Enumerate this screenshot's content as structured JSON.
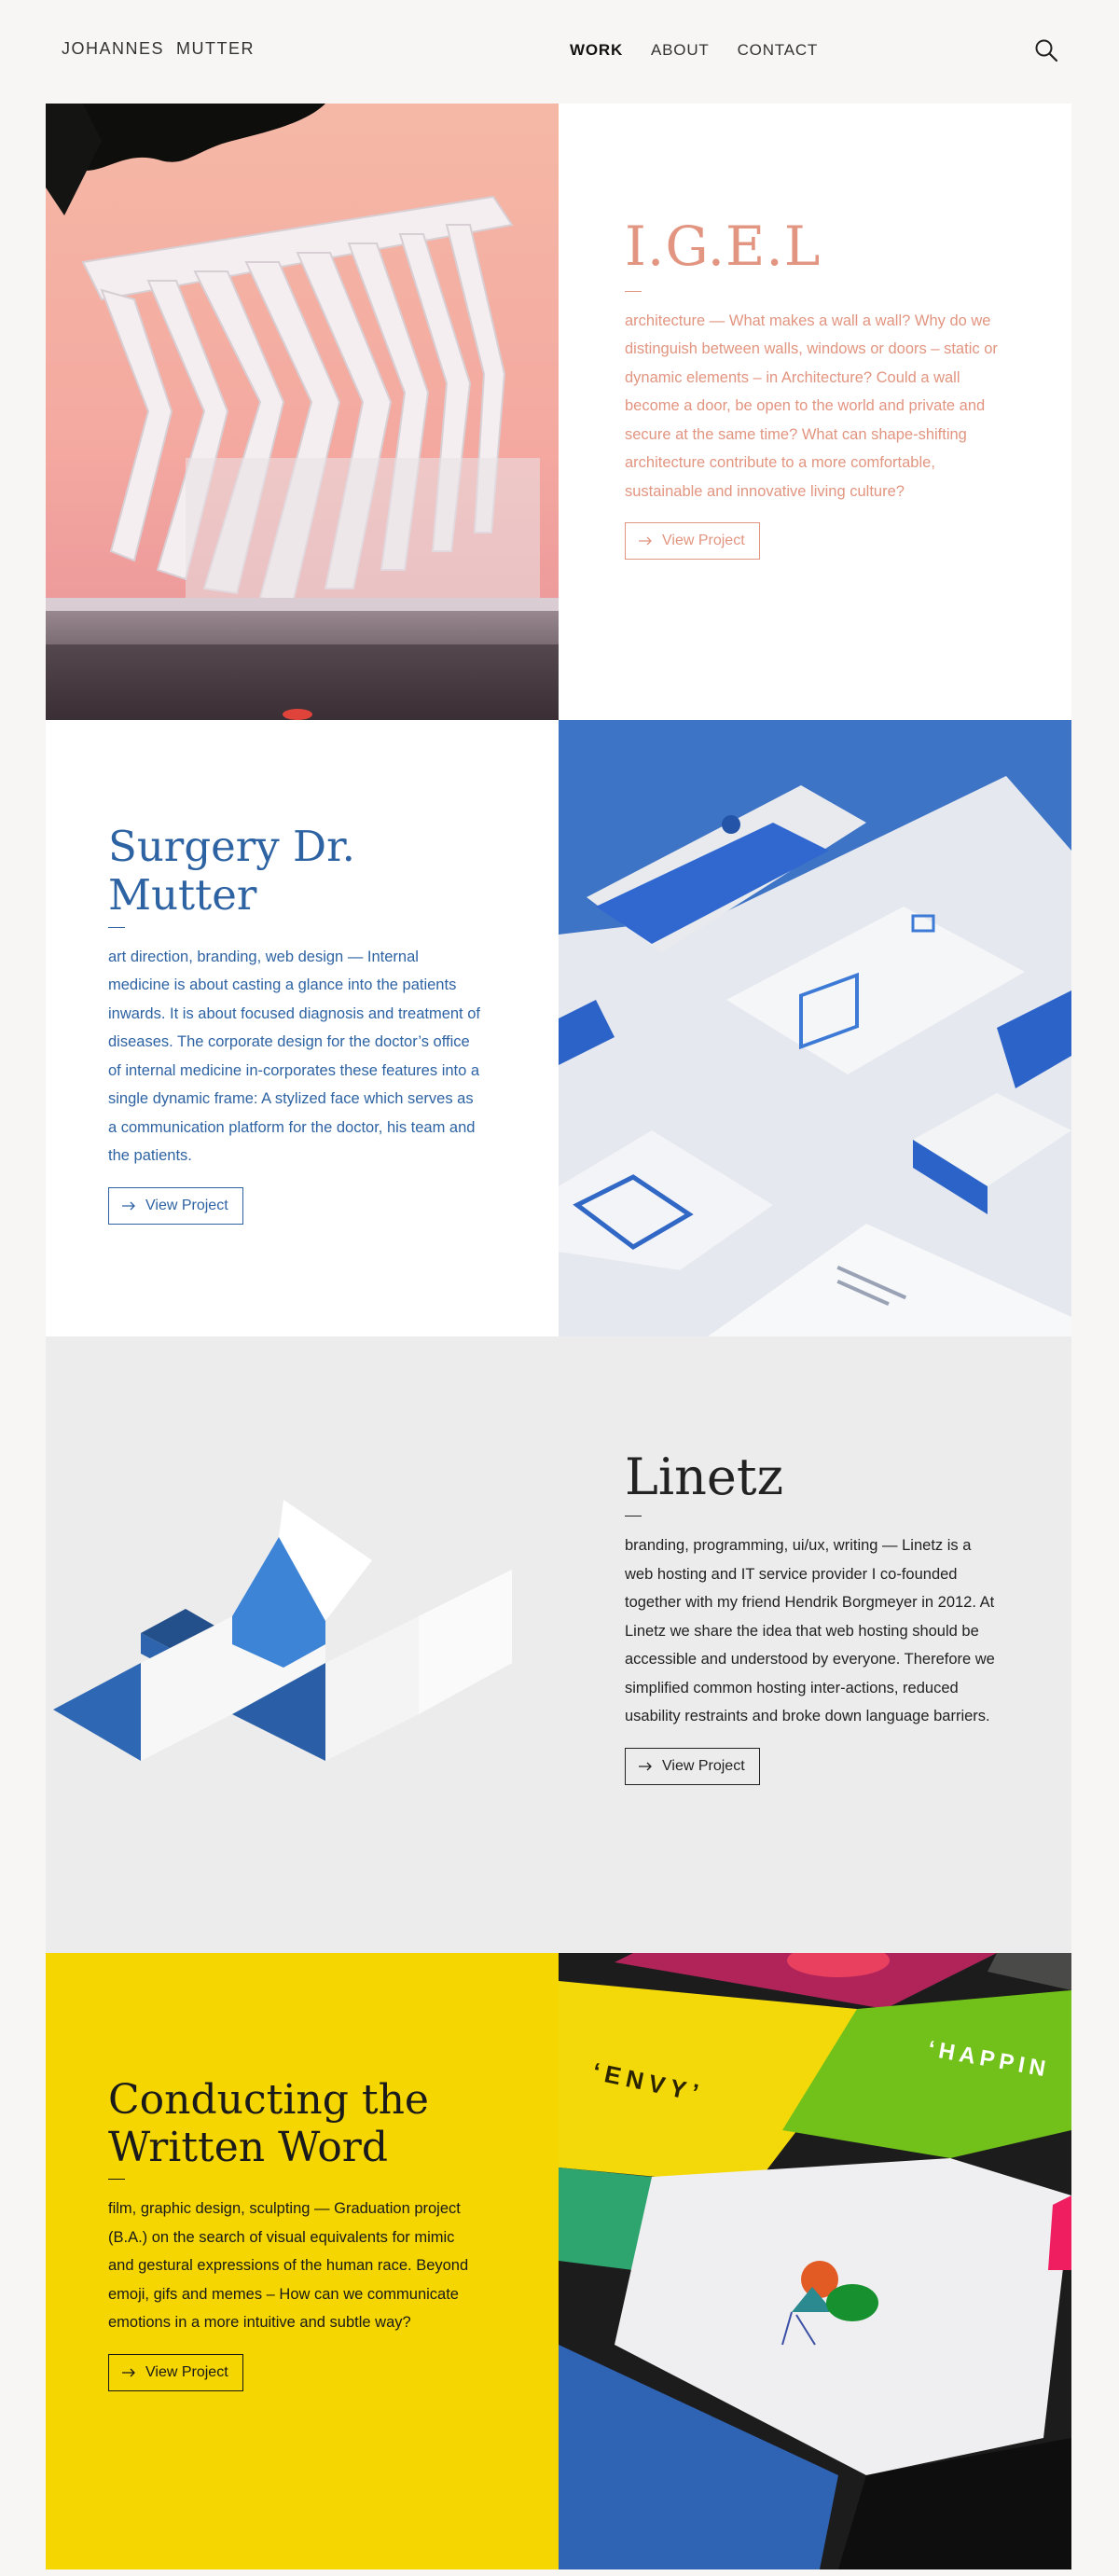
{
  "header": {
    "logo": "JOHANNES  MUTTER",
    "nav": [
      {
        "label": "WORK",
        "active": true
      },
      {
        "label": "ABOUT",
        "active": false
      },
      {
        "label": "CONTACT",
        "active": false
      }
    ],
    "search_icon": "search-icon"
  },
  "projects": [
    {
      "title": "I.G.E.L",
      "description": "architecture — What makes a wall a wall? Why do we distinguish between walls, windows or doors – static or dynamic elements – in Architecture? Could a wall become a door, be open to the world and private and secure at the same time? What can shape-shifting architecture contribute to a more comfortable, sustainable and innovative living culture?",
      "button": "View Project",
      "accent": "#e29580"
    },
    {
      "title": "Surgery Dr. Mutter",
      "description": "art direction, branding, web design — Internal medicine is about casting a glance into the patients inwards. It is about focused diagnosis and treatment of diseases. The corporate design for the doctor’s office of internal medicine in-corporates these features into a single dynamic frame: A stylized face which serves as a communication platform for the doctor, his team and the patients.",
      "button": "View Project",
      "accent": "#2e63a3"
    },
    {
      "title": "Linetz",
      "description": "branding, programming, ui/ux, writing — Linetz is a web hosting and IT service provider I co-founded together with my friend Hendrik Borgmeyer in 2012. At Linetz we share the idea that web hosting should be accessible and understood by everyone. Therefore we simplified common hosting inter-actions, reduced usability restraints and broke down language barriers.",
      "button": "View Project",
      "accent": "#222222"
    },
    {
      "title": "Conducting the Written Word",
      "description": "film, graphic design, sculpting — Graduation project (B.A.) on the search of visual equivalents for mimic and gestural expressions of the human race. Beyond emoji, gifs and memes – How can we communicate emotions in a more intuitive and subtle way?",
      "button": "View Project",
      "accent": "#f6d600"
    }
  ],
  "artwork_text": {
    "envy": "‘ENVY’",
    "happiness": "‘HAPPIN"
  }
}
